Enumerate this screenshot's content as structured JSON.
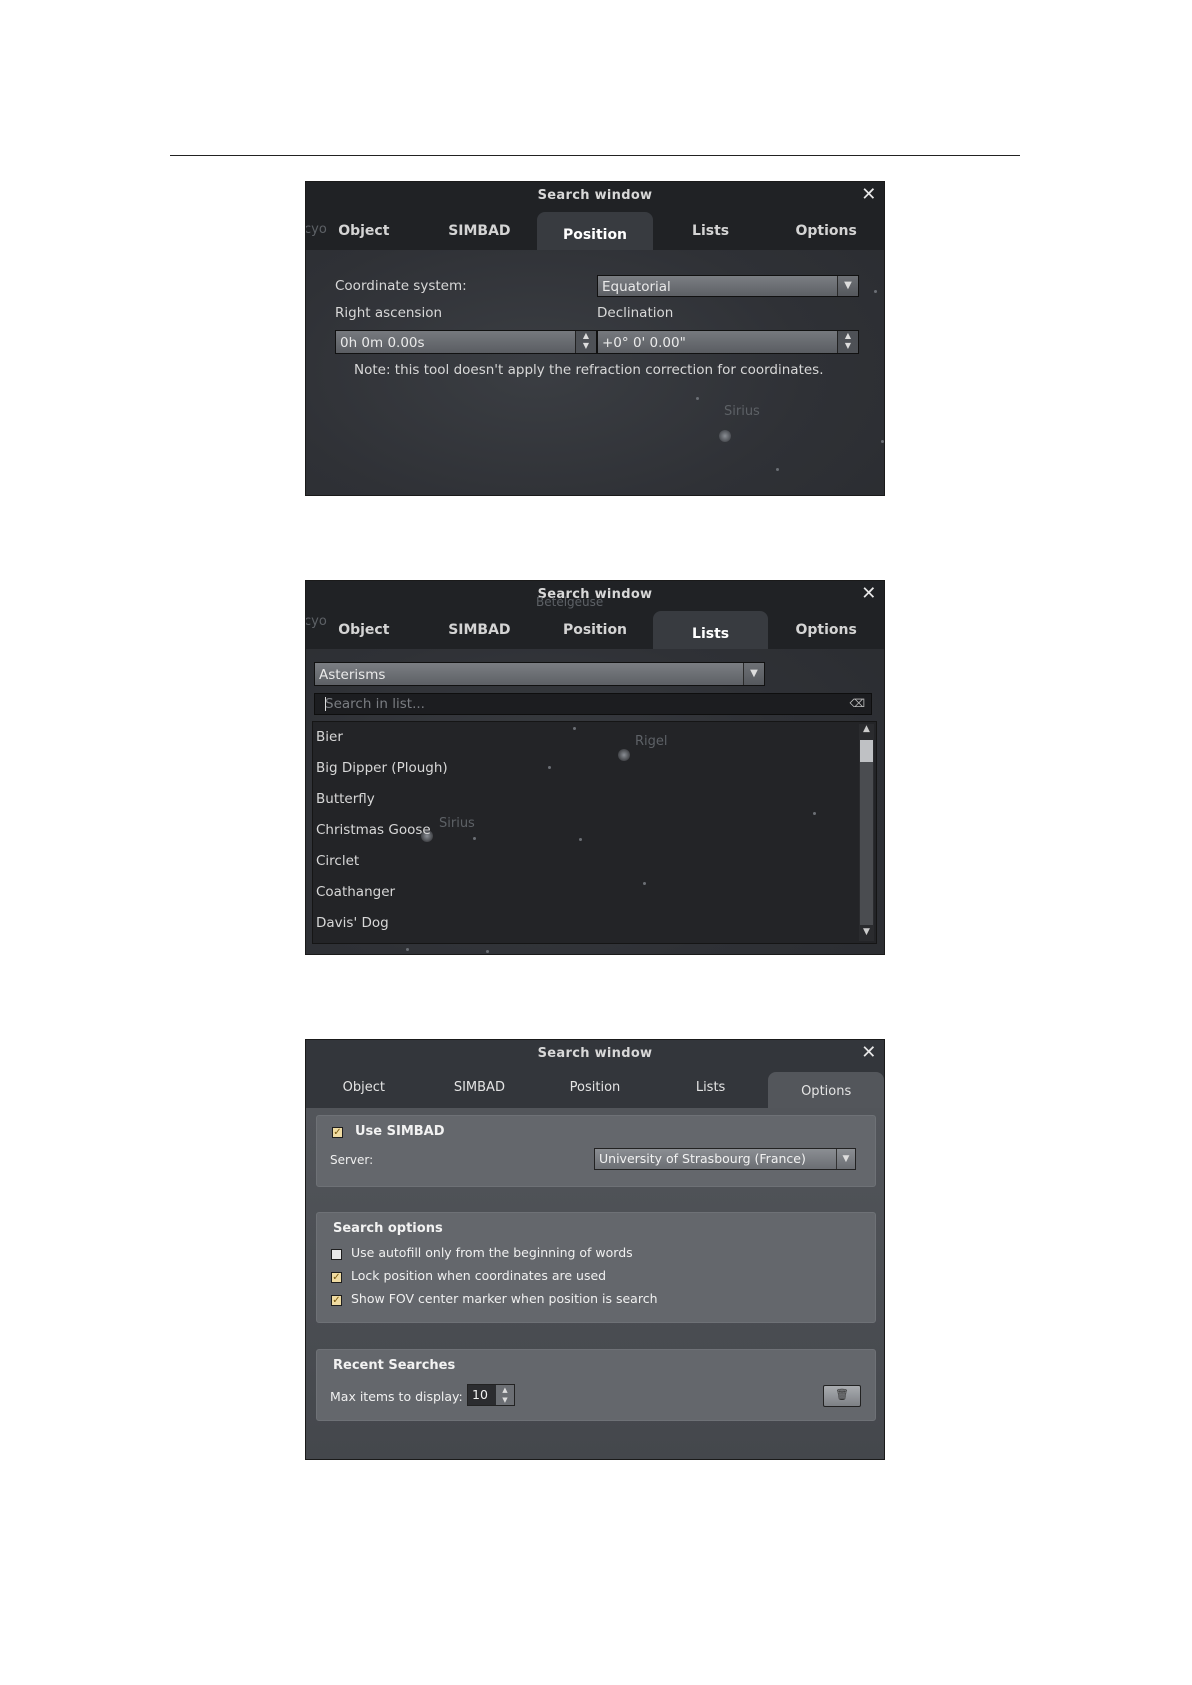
{
  "window_title": "Search window",
  "close_symbol": "✕",
  "tabs": [
    "Object",
    "SIMBAD",
    "Position",
    "Lists",
    "Options"
  ],
  "position_tab": {
    "coord_system_label": "Coordinate system:",
    "coord_system_value": "Equatorial",
    "ra_label": "Right ascension",
    "ra_value": "0h 0m 0.00s",
    "dec_label": "Declination",
    "dec_value": "+0° 0' 0.00\"",
    "note": "Note: this tool doesn't apply the refraction correction for coordinates.",
    "sky_labels": [
      "Sirius",
      "cyo"
    ]
  },
  "lists_tab": {
    "list_type": "Asterisms",
    "search_placeholder": "Search in list...",
    "items": [
      "Bier",
      "Big Dipper (Plough)",
      "Butterfly",
      "Christmas Goose",
      "Circlet",
      "Coathanger",
      "Davis' Dog"
    ],
    "sky_labels": [
      "Rigel",
      "Sirius",
      "Betelgeuse",
      "cyo"
    ]
  },
  "options_tab": {
    "use_simbad_label": "Use SIMBAD",
    "use_simbad_checked": true,
    "server_label": "Server:",
    "server_value": "University of Strasbourg (France)",
    "search_options_title": "Search options",
    "search_options": [
      {
        "label": "Use autofill only from the beginning of words",
        "checked": false
      },
      {
        "label": "Lock position when coordinates are used",
        "checked": true
      },
      {
        "label": "Show FOV center marker when position is search",
        "checked": true
      }
    ],
    "recent_title": "Recent Searches",
    "max_items_label": "Max items to display:",
    "max_items_value": "10"
  },
  "icons": {
    "dropdown_arrow": "▼",
    "spin_up": "▲",
    "spin_down": "▼",
    "clear": "⌫",
    "check": "✓",
    "trash": "🗑"
  }
}
